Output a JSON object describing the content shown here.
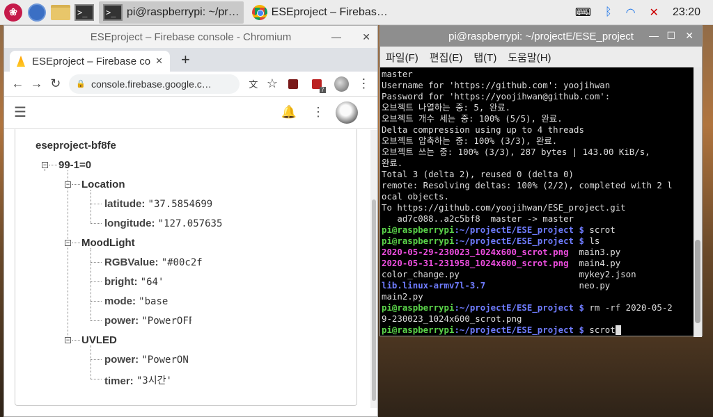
{
  "taskbar": {
    "task_terminal": "pi@raspberrypi: ~/pr…",
    "task_chromium": "ESEproject – Firebas…",
    "clock": "23:20"
  },
  "chromium": {
    "window_title": "ESEproject – Firebase console - Chromium",
    "tab_title": "ESEproject – Firebase co",
    "url": "console.firebase.google.c…",
    "ext_badge": "7"
  },
  "database": {
    "root": "eseproject-bf8fe",
    "node": "99-1=0",
    "location": {
      "label": "Location",
      "latitude_key": "latitude:",
      "latitude_val": "\"37.5854699",
      "longitude_key": "longitude:",
      "longitude_val": "\"127.0576355"
    },
    "moodlight": {
      "label": "MoodLight",
      "rgb_key": "RGBValue:",
      "rgb_val": "\"#00c2f",
      "bright_key": "bright:",
      "bright_val": "\"64'",
      "mode_key": "mode:",
      "mode_val": "\"base",
      "power_key": "power:",
      "power_val": "\"PowerOFF"
    },
    "uvled": {
      "label": "UVLED",
      "power_key": "power:",
      "power_val": "\"PowerON",
      "timer_key": "timer:",
      "timer_val": "\"3시간'"
    }
  },
  "terminal": {
    "window_title": "pi@raspberrypi: ~/projectE/ESE_project",
    "menu": [
      "파일(F)",
      "편집(E)",
      "탭(T)",
      "도움말(H)"
    ],
    "prompt": "pi@raspberrypi",
    "path": ":~/projectE/ESE_project $",
    "lines": {
      "l1": "master",
      "l2": "Username for 'https://github.com': yoojihwan",
      "l3": "Password for 'https://yoojihwan@github.com':",
      "l4": "오브젝트 나열하는 중: 5, 완료.",
      "l5": "오브젝트 개수 세는 중: 100% (5/5), 완료.",
      "l6": "Delta compression using up to 4 threads",
      "l7": "오브젝트 압축하는 중: 100% (3/3), 완료.",
      "l8": "오브젝트 쓰는 중: 100% (3/3), 287 bytes | 143.00 KiB/s,",
      "l9": "완료.",
      "l10": "Total 3 (delta 2), reused 0 (delta 0)",
      "l11": "remote: Resolving deltas: 100% (2/2), completed with 2 l",
      "l12": "ocal objects.",
      "l13": "To https://github.com/yoojihwan/ESE_project.git",
      "l14": "   ad7c088..a2c5bf8  master -> master",
      "cmd1": " scrot",
      "cmd2": " ls",
      "f1": "2020-05-29-230023_1024x600_scrot.png",
      "f1b": "  main3.py",
      "f2": "2020-05-31-231958_1024x600_scrot.png",
      "f2b": "  main4.py",
      "f3": "color_change.py                       mykey2.json",
      "f4": "lib.linux-armv7l-3.7",
      "f4b": "                  neo.py",
      "f5": "main2.py",
      "cmd3": " rm -rf 2020-05-2",
      "cmd3b": "9-230023_1024x600_scrot.png",
      "cmd4": " scrot"
    }
  }
}
